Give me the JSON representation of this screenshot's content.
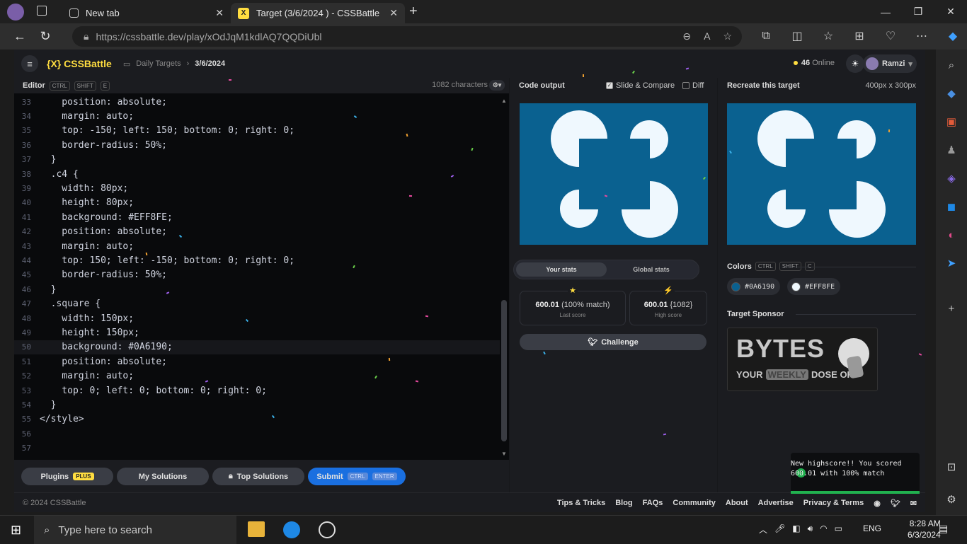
{
  "browser": {
    "tabs": [
      {
        "label": "New tab"
      },
      {
        "label": "Target (3/6/2024 ) - CSSBattle"
      }
    ],
    "new_tab_icon": "plus-icon",
    "url": "https://cssbattle.dev/play/xOdJqM1kdlAQ7QQDiUbl",
    "window_controls": [
      "minimize-icon",
      "restore-icon",
      "close-icon"
    ]
  },
  "app": {
    "brand": "{X} CSSBattle",
    "breadcrumb": {
      "section": "Daily Targets",
      "current": "3/6/2024"
    },
    "online": {
      "count": "46",
      "label": "Online"
    },
    "user": "Ramzi"
  },
  "editor": {
    "title": "Editor",
    "shortcut": [
      "CTRL",
      "SHIFT",
      "E"
    ],
    "characters": "1082 characters",
    "lines": [
      {
        "n": "33",
        "t": "    position: absolute;"
      },
      {
        "n": "34",
        "t": "    margin: auto;"
      },
      {
        "n": "35",
        "t": "    top: -150; left: 150; bottom: 0; right: 0;"
      },
      {
        "n": "36",
        "t": "    border-radius: 50%;"
      },
      {
        "n": "37",
        "t": "  }"
      },
      {
        "n": "38",
        "t": "  .c4 {"
      },
      {
        "n": "39",
        "t": "    width: 80px;"
      },
      {
        "n": "40",
        "t": "    height: 80px;"
      },
      {
        "n": "41",
        "t": "    background: #EFF8FE;"
      },
      {
        "n": "42",
        "t": "    position: absolute;"
      },
      {
        "n": "43",
        "t": "    margin: auto;"
      },
      {
        "n": "44",
        "t": "    top: 150; left: -150; bottom: 0; right: 0;"
      },
      {
        "n": "45",
        "t": "    border-radius: 50%;"
      },
      {
        "n": "46",
        "t": "  }"
      },
      {
        "n": "47",
        "t": "  .square {"
      },
      {
        "n": "48",
        "t": "    width: 150px;"
      },
      {
        "n": "49",
        "t": "    height: 150px;"
      },
      {
        "n": "50",
        "t": "    background: #0A6190;"
      },
      {
        "n": "51",
        "t": "    position: absolute;"
      },
      {
        "n": "52",
        "t": "    margin: auto;"
      },
      {
        "n": "53",
        "t": "    top: 0; left: 0; bottom: 0; right: 0;"
      },
      {
        "n": "54",
        "t": "  }"
      },
      {
        "n": "55",
        "t": "</style>"
      },
      {
        "n": "56",
        "t": ""
      },
      {
        "n": "57",
        "t": ""
      }
    ],
    "highlighted_line": "50"
  },
  "buttons": {
    "plugins": "Plugins",
    "plugins_badge": "PLUS",
    "my_solutions": "My Solutions",
    "top_solutions": "Top Solutions",
    "submit": "Submit",
    "submit_kbd": [
      "CTRL",
      "ENTER"
    ]
  },
  "output": {
    "title": "Code output",
    "slide_compare": "Slide & Compare",
    "diff": "Diff",
    "tabs": [
      "Your stats",
      "Global stats"
    ],
    "last_score": {
      "value": "600.01",
      "detail": "(100% match)",
      "label": "Last score"
    },
    "high_score": {
      "value": "600.01",
      "detail": "{1082}",
      "label": "High score"
    },
    "challenge": "Challenge"
  },
  "target": {
    "title": "Recreate this target",
    "size": "400px x 300px",
    "colors_label": "Colors",
    "colors_kbd": [
      "CTRL",
      "SHIFT",
      "C"
    ],
    "colors": [
      "#0A6190",
      "#EFF8FE"
    ],
    "sponsor_label": "Target Sponsor",
    "sponsor": {
      "title": "BYTES",
      "tag_a": "YOUR",
      "tag_b": "WEEKLY",
      "tag_c": "DOSE OF"
    }
  },
  "footer": {
    "copyright": "© 2024 CSSBattle",
    "links": [
      "Tips & Tricks",
      "Blog",
      "FAQs",
      "Community",
      "About",
      "Advertise",
      "Privacy & Terms"
    ]
  },
  "toast": {
    "text": "New highscore!! You scored 600.01 with 100% match"
  },
  "taskbar": {
    "search_placeholder": "Type here to search",
    "lang": "ENG",
    "time": "8:28 AM",
    "date": "6/3/2024"
  }
}
